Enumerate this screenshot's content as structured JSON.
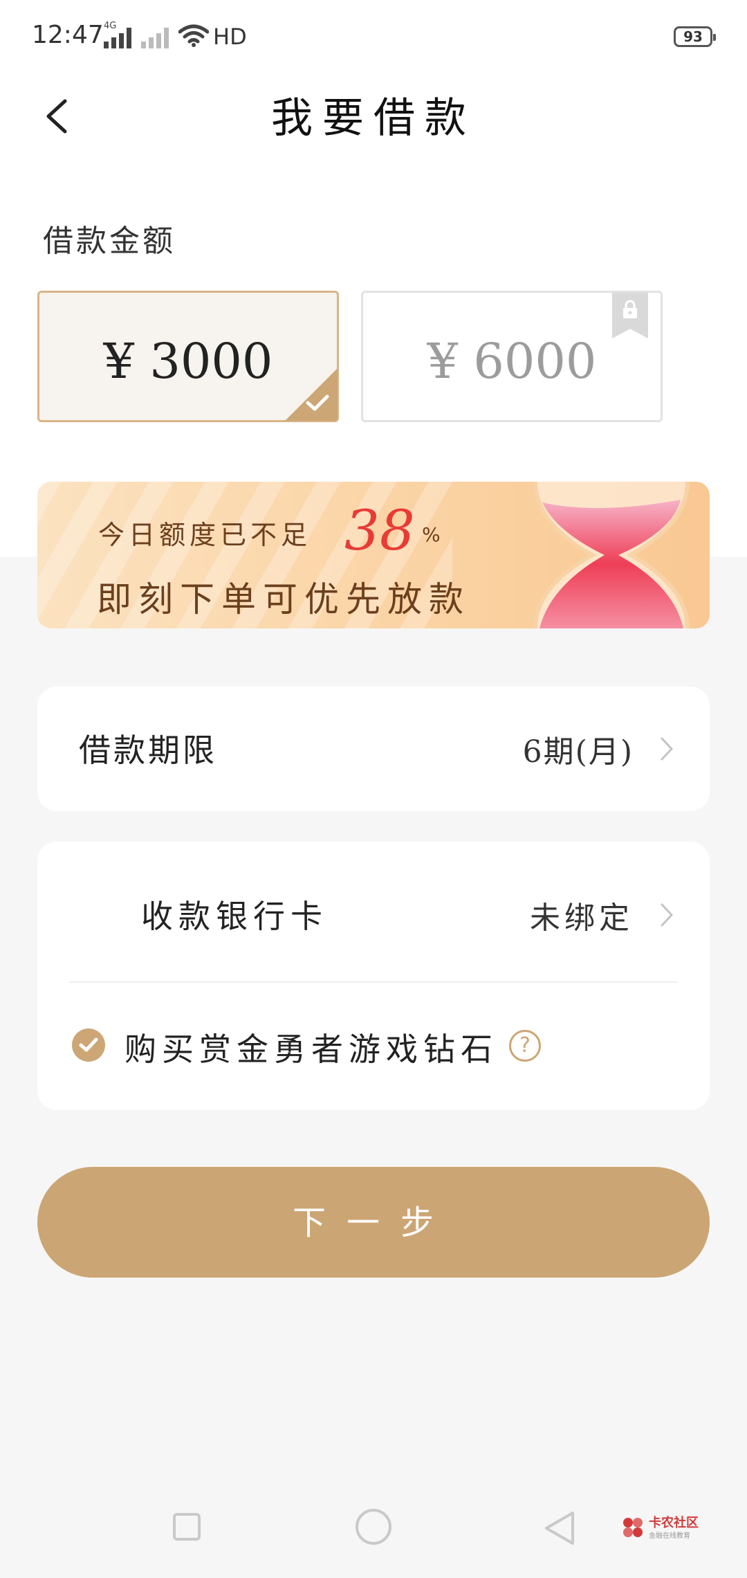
{
  "status_bar": {
    "time": "12:47",
    "network_tag": "4G",
    "connection": "HD",
    "battery": "93"
  },
  "header": {
    "title": "我要借款"
  },
  "amount": {
    "label": "借款金额",
    "options": [
      {
        "text": "¥ 3000",
        "selected": true,
        "locked": false
      },
      {
        "text": "¥ 6000",
        "selected": false,
        "locked": true
      }
    ]
  },
  "banner": {
    "line1": "今日额度已不足",
    "percent": "38",
    "percent_sign": "%",
    "line2": "即刻下单可优先放款"
  },
  "term": {
    "label": "借款期限",
    "value": "6期(月)"
  },
  "bank": {
    "label": "收款银行卡",
    "value": "未绑定",
    "purchase_label": "购买赏金勇者游戏钻石",
    "purchase_checked": true
  },
  "actions": {
    "next_label": "下一步"
  },
  "watermark": {
    "name": "卡农社区",
    "sub": "金融在线教育"
  },
  "colors": {
    "accent": "#cca574",
    "highlight_red": "#e83b35",
    "selected_border": "#d8b487",
    "background": "#f6f6f6"
  }
}
